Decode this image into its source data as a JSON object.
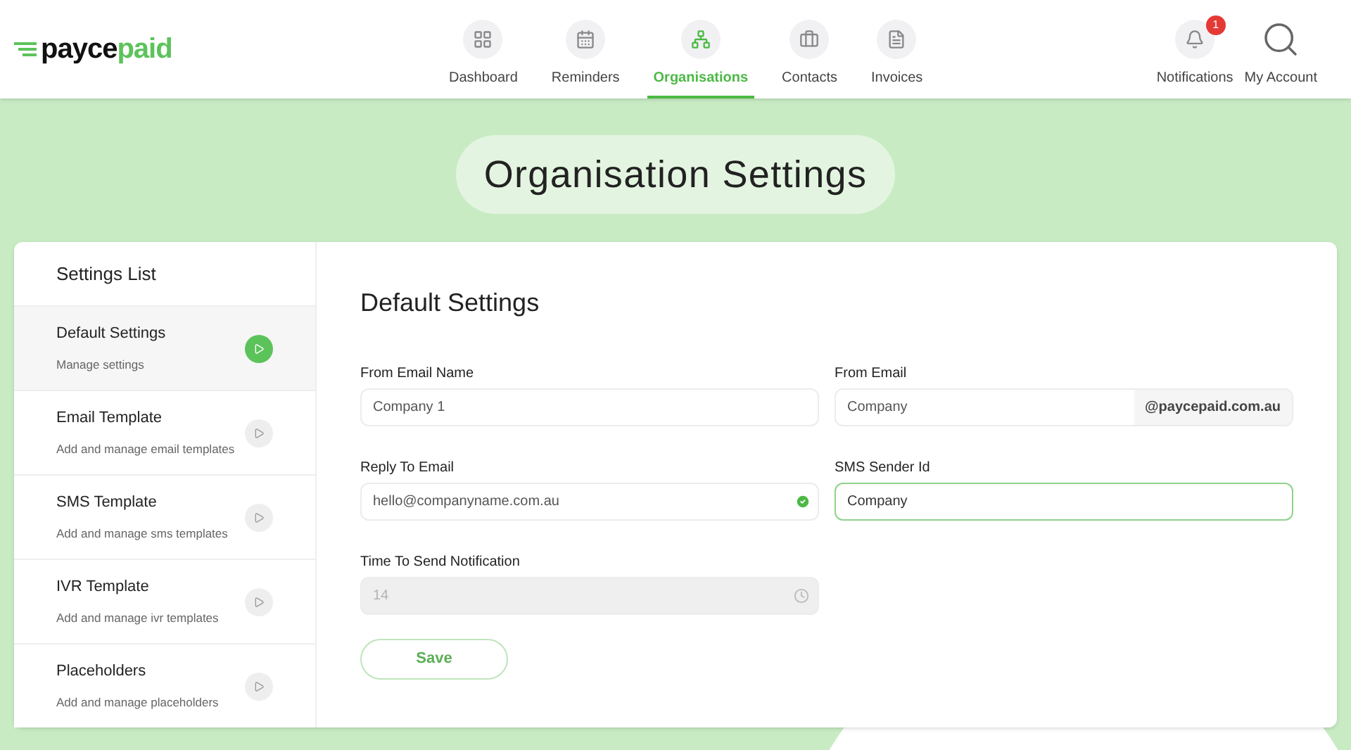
{
  "logo": {
    "part_1": "payce",
    "part_2": "paid"
  },
  "nav": [
    {
      "label": "Dashboard",
      "selected": false
    },
    {
      "label": "Reminders",
      "selected": false
    },
    {
      "label": "Organisations",
      "selected": true
    },
    {
      "label": "Contacts",
      "selected": false
    },
    {
      "label": "Invoices",
      "selected": false
    }
  ],
  "notifications": {
    "label": "Notifications",
    "count": "1"
  },
  "account": {
    "label": "My Account"
  },
  "page_title": "Organisation Settings",
  "settings_list": {
    "title": "Settings List",
    "items": [
      {
        "title": "Default Settings",
        "subtitle": "Manage settings",
        "selected": true
      },
      {
        "title": "Email Template",
        "subtitle": "Add and manage email templates",
        "selected": false
      },
      {
        "title": "SMS Template",
        "subtitle": "Add and manage sms templates",
        "selected": false
      },
      {
        "title": "IVR Template",
        "subtitle": "Add and manage ivr templates",
        "selected": false
      },
      {
        "title": "Placeholders",
        "subtitle": "Add and manage placeholders",
        "selected": false
      }
    ]
  },
  "form": {
    "title": "Default Settings",
    "fields": [
      {
        "kind": "text",
        "label": "From Email Name",
        "value": "Company 1",
        "focused": false,
        "disabled": false
      },
      {
        "kind": "suffix",
        "label": "From Email",
        "value": "Company",
        "suffix": "@paycepaid.com.au",
        "focused": false,
        "disabled": false
      },
      {
        "kind": "valid",
        "label": "Reply To Email",
        "value": "hello@companyname.com.au",
        "focused": false,
        "disabled": false
      },
      {
        "kind": "text",
        "label": "SMS Sender Id",
        "value": "Company",
        "focused": true,
        "disabled": false
      },
      {
        "kind": "time",
        "label": "Time To Send Notification",
        "value": "14",
        "focused": false,
        "disabled": true
      }
    ],
    "save": "Save"
  }
}
